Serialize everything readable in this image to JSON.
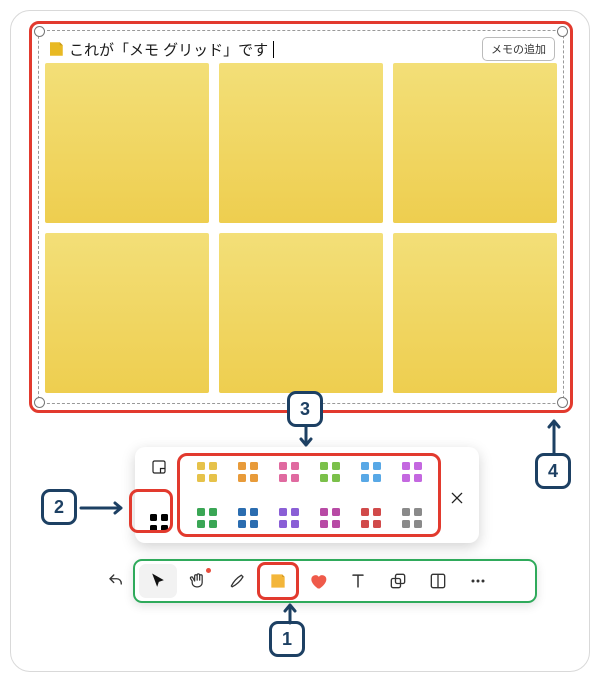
{
  "memo": {
    "title": "これが「メモ グリッド」です",
    "add_button": "メモの追加",
    "sticky_count": 6
  },
  "popover": {
    "close": "×",
    "row1_colors": [
      "#e6c24a",
      "#e89b3a",
      "#e06aa0",
      "#7bc04a",
      "#58a8e6",
      "#c468e0"
    ],
    "row2_colors": [
      "#3aa655",
      "#2b6db0",
      "#8a5fd6",
      "#b84aa5",
      "#d14a4a",
      "#8a8a8a"
    ]
  },
  "callouts": {
    "c1": "1",
    "c2": "2",
    "c3": "3",
    "c4": "4"
  },
  "colors": {
    "accent_red": "#e23a2e",
    "accent_green": "#2faa5b",
    "navy": "#1d4063"
  }
}
